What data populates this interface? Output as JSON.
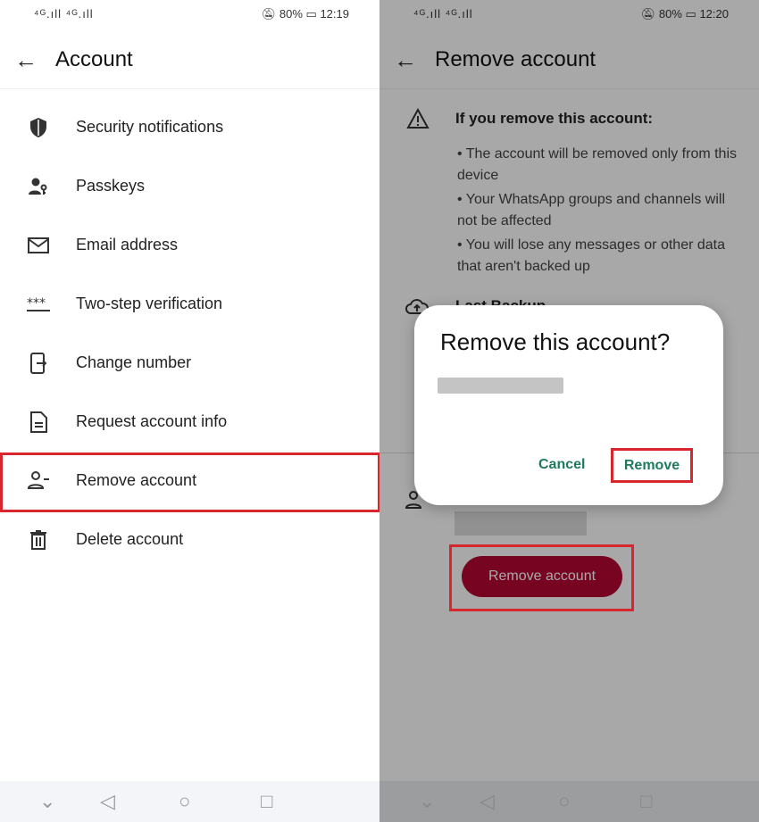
{
  "left": {
    "status": {
      "signal": "⁴ᴳ.ıll ⁴ᴳ.ıll",
      "battery": "80%",
      "time": "12:19"
    },
    "header": {
      "title": "Account"
    },
    "items": [
      {
        "label": "Security notifications",
        "icon": "shield-icon"
      },
      {
        "label": "Passkeys",
        "icon": "person-key-icon"
      },
      {
        "label": "Email address",
        "icon": "mail-icon"
      },
      {
        "label": "Two-step verification",
        "icon": "asterisks-icon"
      },
      {
        "label": "Change number",
        "icon": "phone-transfer-icon"
      },
      {
        "label": "Request account info",
        "icon": "document-icon"
      },
      {
        "label": "Remove account",
        "icon": "person-remove-icon"
      },
      {
        "label": "Delete account",
        "icon": "trash-icon"
      }
    ],
    "highlighted_item": "Remove account"
  },
  "right": {
    "status": {
      "signal": "⁴ᴳ.ıll ⁴ᴳ.ıll",
      "battery": "80%",
      "time": "12:20"
    },
    "header": {
      "title": "Remove account"
    },
    "warning_title": "If you remove this account:",
    "bullets": [
      "The account will be removed only from this device",
      "Your WhatsApp groups and channels will not be affected",
      "You will lose any messages or other data that aren't backed up"
    ],
    "backup_label": "Last Backup",
    "remove_button": "Remove account",
    "dialog": {
      "title": "Remove this account?",
      "cancel": "Cancel",
      "confirm": "Remove"
    }
  },
  "colors": {
    "accent_green": "#1f7a5c",
    "danger": "#a3002b",
    "highlight": "#d9262e"
  }
}
